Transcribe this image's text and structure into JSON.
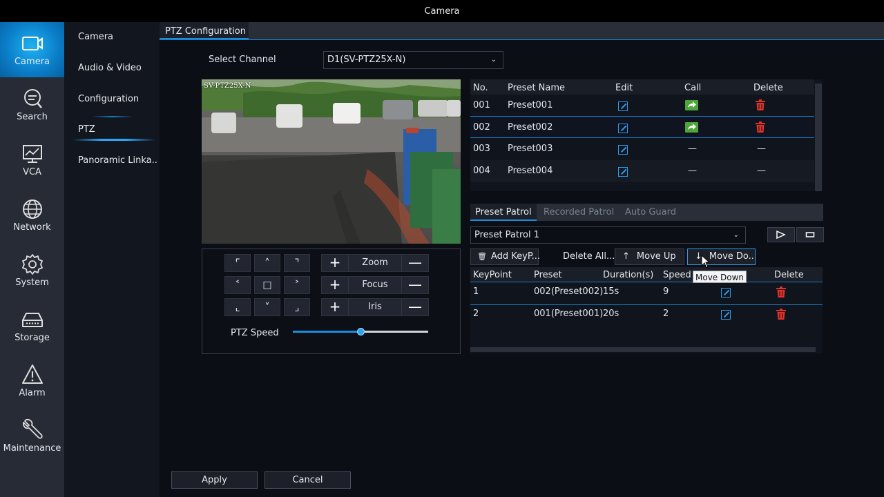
{
  "window": {
    "title": "Camera"
  },
  "main_nav": {
    "items": [
      {
        "label": "Camera",
        "icon": "camera-icon",
        "active": true
      },
      {
        "label": "Search",
        "icon": "search-icon"
      },
      {
        "label": "VCA",
        "icon": "vca-icon"
      },
      {
        "label": "Network",
        "icon": "globe-icon"
      },
      {
        "label": "System",
        "icon": "gear-icon"
      },
      {
        "label": "Storage",
        "icon": "storage-icon"
      },
      {
        "label": "Alarm",
        "icon": "warning-icon"
      },
      {
        "label": "Maintenance",
        "icon": "wrench-icon"
      }
    ]
  },
  "sub_nav": {
    "items": [
      {
        "label": "Camera"
      },
      {
        "label": "Audio & Video"
      },
      {
        "label": "Configuration"
      },
      {
        "label": "PTZ",
        "active": true
      },
      {
        "label": "Panoramic Linka.."
      }
    ]
  },
  "page": {
    "tab": "PTZ Configuration"
  },
  "channel": {
    "label": "Select Channel",
    "value": "D1(SV-PTZ25X-N)"
  },
  "video": {
    "osd": "SV-PTZ25X-N"
  },
  "ptz_controls": {
    "zoom": "Zoom",
    "focus": "Focus",
    "iris": "Iris",
    "speed_label": "PTZ Speed",
    "speed_level": 0.5
  },
  "presets": {
    "columns": [
      "No.",
      "Preset Name",
      "Edit",
      "Call",
      "Delete"
    ],
    "rows": [
      {
        "no": "001",
        "name": "Preset001",
        "callable": true
      },
      {
        "no": "002",
        "name": "Preset002",
        "callable": true,
        "selected": true
      },
      {
        "no": "003",
        "name": "Preset003",
        "callable": false,
        "placeholder": "—"
      },
      {
        "no": "004",
        "name": "Preset004",
        "callable": false,
        "placeholder": "—"
      }
    ]
  },
  "patrol": {
    "tabs": [
      "Preset Patrol",
      "Recorded Patrol",
      "Auto Guard"
    ],
    "selected": "Preset Patrol 1",
    "buttons": {
      "add": "Add KeyP...",
      "delete_all": "Delete All...",
      "move_up": "Move Up",
      "move_down": "Move Do.."
    },
    "tooltip": "Move Down",
    "columns": [
      "KeyPoint",
      "Preset",
      "Duration(s)",
      "Speed",
      "Delete"
    ],
    "rows": [
      {
        "keypoint": "1",
        "preset": "002(Preset002)",
        "duration": "15s",
        "speed": "9"
      },
      {
        "keypoint": "2",
        "preset": "001(Preset001)",
        "duration": "20s",
        "speed": "2"
      }
    ]
  },
  "footer": {
    "apply": "Apply",
    "cancel": "Cancel"
  },
  "colors": {
    "accent": "#1b8edb",
    "call": "#4ea63a",
    "delete": "#e0312b"
  }
}
